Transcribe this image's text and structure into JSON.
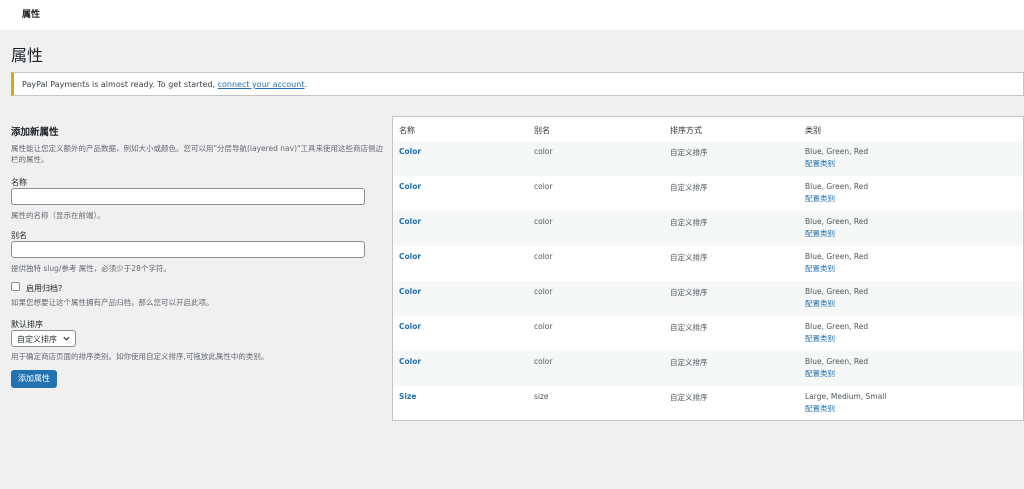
{
  "topbar": {
    "title": "属性"
  },
  "page_title": "属性",
  "notice": {
    "text": "PayPal Payments is almost ready. To get started,",
    "link": "connect your account",
    "suffix": "."
  },
  "form": {
    "heading": "添加新属性",
    "intro": "属性能让您定义额外的产品数据，例如大小或颜色。您可以用\"分层导航(layered nav)\"工具来使用这些商店侧边栏的属性。",
    "name_label": "名称",
    "name_value": "",
    "name_help": "属性的名称（显示在前端）。",
    "slug_label": "别名",
    "slug_value": "",
    "slug_help": "提供独特 slug/参考 属性，必须少于28个字符。",
    "archive_label": "启用归档?",
    "archive_help": "如果您想要让这个属性拥有产品归档，那么您可以开启此项。",
    "order_label": "默认排序",
    "order_value": "自定义排序",
    "order_help": "用于确定商店页面的排序类别。如你使用自定义排序,可拖放此属性中的类别。",
    "submit_label": "添加属性"
  },
  "table": {
    "headers": [
      "名称",
      "别名",
      "排序方式",
      "类别"
    ],
    "configure_label": "配置类别",
    "rows": [
      {
        "name": "Color",
        "slug": "color",
        "order": "自定义排序",
        "terms": "Blue, Green, Red"
      },
      {
        "name": "Color",
        "slug": "color",
        "order": "自定义排序",
        "terms": "Blue, Green, Red"
      },
      {
        "name": "Color",
        "slug": "color",
        "order": "自定义排序",
        "terms": "Blue, Green, Red"
      },
      {
        "name": "Color",
        "slug": "color",
        "order": "自定义排序",
        "terms": "Blue, Green, Red"
      },
      {
        "name": "Color",
        "slug": "color",
        "order": "自定义排序",
        "terms": "Blue, Green, Red"
      },
      {
        "name": "Color",
        "slug": "color",
        "order": "自定义排序",
        "terms": "Blue, Green, Red"
      },
      {
        "name": "Color",
        "slug": "color",
        "order": "自定义排序",
        "terms": "Blue, Green, Red"
      },
      {
        "name": "Size",
        "slug": "size",
        "order": "自定义排序",
        "terms": "Large, Medium, Small"
      }
    ]
  },
  "colors": {
    "accent": "#2271b1",
    "notice_border": "#dba617",
    "background": "#f0f0f1"
  }
}
